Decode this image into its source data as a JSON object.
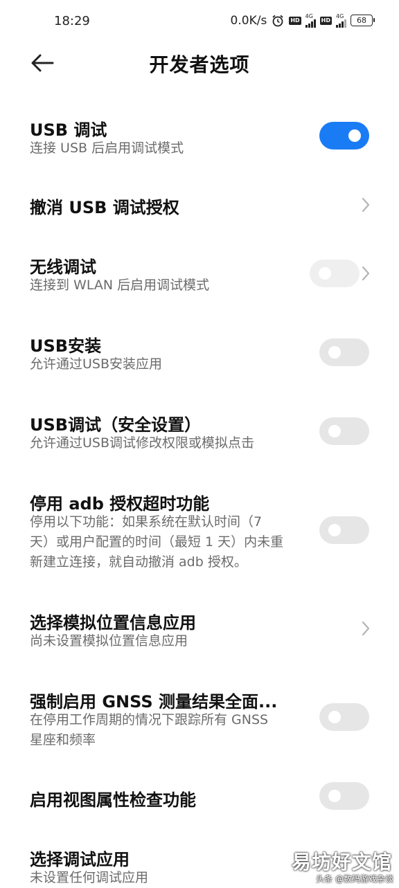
{
  "status_bar": {
    "time": "18:29",
    "net_speed": "0.0K/s",
    "alarm_icon": "alarm-clock-icon",
    "hd_label": "HD",
    "sim1_network": "4G",
    "sim2_network": "4G",
    "battery": "68"
  },
  "header": {
    "title": "开发者选项",
    "back_icon": "back-arrow-icon"
  },
  "colors": {
    "accent": "#1a7cf5",
    "toggle_off": "#e6e6e6",
    "subtitle": "#6b6b6b"
  },
  "settings": [
    {
      "title": "USB 调试",
      "subtitle": "连接 USB 后启用调试模式",
      "control": "toggle",
      "state": "on"
    },
    {
      "title": "撤消 USB 调试授权",
      "subtitle": "",
      "control": "chevron"
    },
    {
      "title": "无线调试",
      "subtitle": "连接到 WLAN 后启用调试模式",
      "control": "toggle+chevron",
      "state": "off"
    },
    {
      "title": "USB安装",
      "subtitle": "允许通过USB安装应用",
      "control": "toggle",
      "state": "off"
    },
    {
      "title": "USB调试（安全设置）",
      "subtitle": "允许通过USB调试修改权限或模拟点击",
      "control": "toggle",
      "state": "off"
    },
    {
      "title": "停用 adb 授权超时功能",
      "subtitle_lines": [
        "停用以下功能：如果系统在默认时间（7",
        "天）或用户配置的时间（最短 1 天）内未重",
        "新建立连接，就自动撤消 adb 授权。"
      ],
      "control": "toggle",
      "state": "off"
    },
    {
      "title": "选择模拟位置信息应用",
      "subtitle": "尚未设置模拟位置信息应用",
      "control": "chevron"
    },
    {
      "title": "强制启用 GNSS 测量结果全面...",
      "subtitle_lines": [
        "在停用工作周期的情况下跟踪所有 GNSS",
        "星座和频率"
      ],
      "control": "toggle",
      "state": "off"
    },
    {
      "title": "启用视图属性检查功能",
      "subtitle": "",
      "control": "toggle",
      "state": "off"
    },
    {
      "title": "选择调试应用",
      "subtitle": "未设置任何调试应用",
      "control": "none"
    }
  ],
  "watermark": {
    "main": "易坊好文馆",
    "small": "头条 @数码游戏杂谈"
  }
}
